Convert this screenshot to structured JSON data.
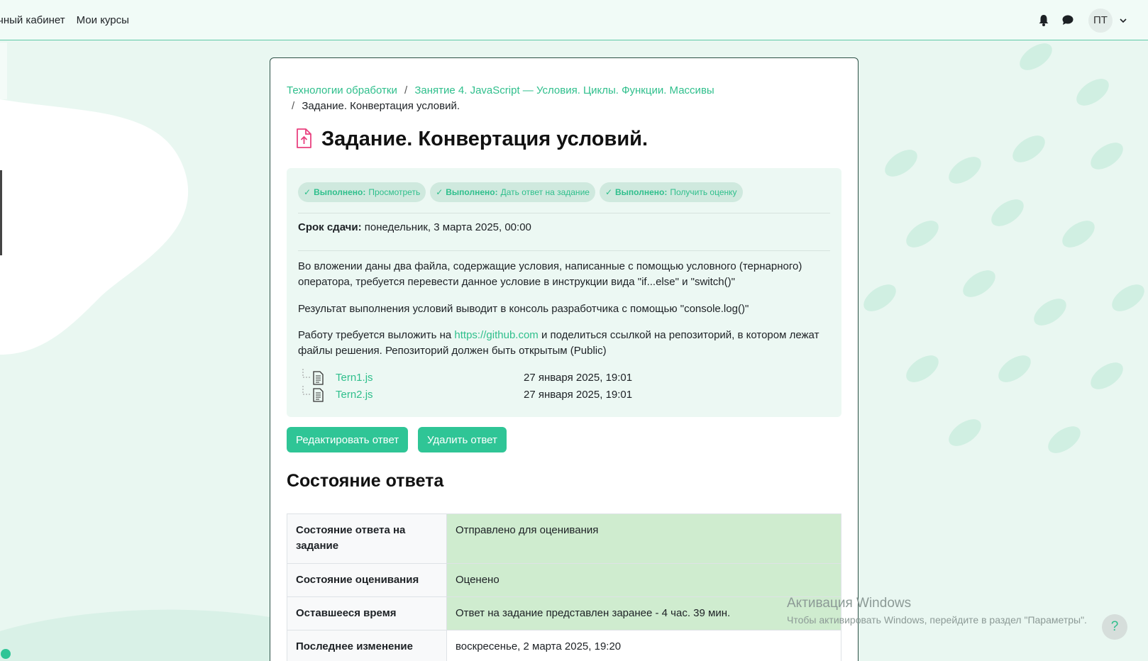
{
  "topnav": {
    "items": [
      "чный кабинет",
      "Мои курсы"
    ],
    "avatar": "ПТ"
  },
  "breadcrumb": {
    "items": [
      "Технологии обработки",
      "Занятие 4. JavaScript — Условия. Циклы. Функции. Массивы",
      "Задание. Конвертация условий."
    ]
  },
  "page": {
    "title": "Задание. Конвертация условий."
  },
  "completion": [
    {
      "status": "Выполнено:",
      "action": "Просмотреть"
    },
    {
      "status": "Выполнено:",
      "action": "Дать ответ на задание"
    },
    {
      "status": "Выполнено:",
      "action": "Получить оценку"
    }
  ],
  "due": {
    "label": "Срок сдачи:",
    "value": "понедельник, 3 марта 2025, 00:00"
  },
  "description": {
    "p1": "Во вложении даны два файла, содержащие условия, написанные с помощью условного (тернарного) оператора, требуется перевести данное условие в инструкции вида \"if...else\" и \"switch()\"",
    "p2": "Результат выполнения условий выводит в консоль разработчика с помощью \"console.log()\"",
    "p3_before": "Работу требуется выложить на ",
    "p3_link": "https://github.com",
    "p3_after": " и поделиться ссылкой на репозиторий, в котором лежат файлы решения. Репозиторий должен быть открытым (Public)"
  },
  "files": [
    {
      "name": "Tern1.js",
      "date": "27 января 2025, 19:01"
    },
    {
      "name": "Tern2.js",
      "date": "27 января 2025, 19:01"
    }
  ],
  "buttons": {
    "edit": "Редактировать ответ",
    "delete": "Удалить ответ"
  },
  "status_section": {
    "heading": "Состояние ответа",
    "rows": [
      {
        "label": "Состояние ответа на задание",
        "value": "Отправлено для оценивания"
      },
      {
        "label": "Состояние оценивания",
        "value": "Оценено"
      },
      {
        "label": "Оставшееся время",
        "value": "Ответ на задание представлен заранее - 4 час. 39 мин."
      },
      {
        "label": "Последнее изменение",
        "value": "воскресенье, 2 марта 2025, 19:20"
      }
    ]
  },
  "watermark": {
    "line1": "Активация Windows",
    "line2": "Чтобы активировать Windows, перейдите в раздел \"Параметры\"."
  },
  "help": "?",
  "colors": {
    "accent": "#2fc596",
    "link": "#2fbf8c",
    "success_cell": "#cfeccf"
  }
}
